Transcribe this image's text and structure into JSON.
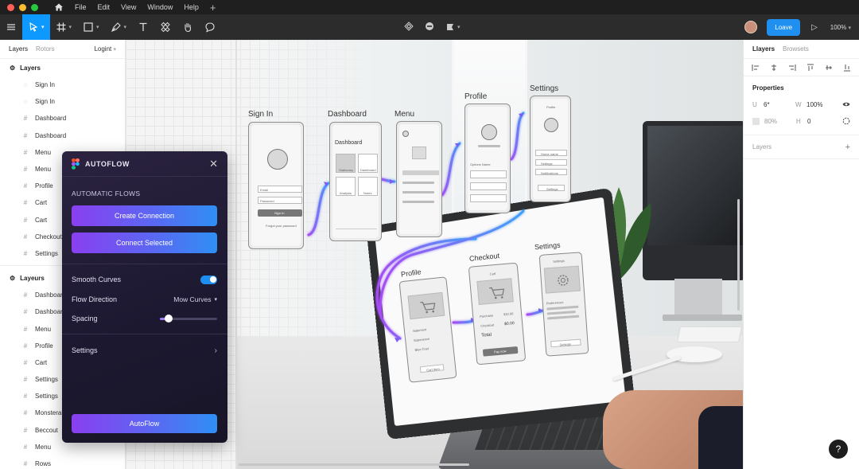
{
  "menubar": {
    "items": [
      "File",
      "Edit",
      "View",
      "Window",
      "Help"
    ],
    "traffic": [
      "#ff5f57",
      "#febc2e",
      "#28c840"
    ]
  },
  "toolbar": {
    "leave_label": "Loave",
    "zoom": "100%",
    "accent": "#0d99ff"
  },
  "left_panel": {
    "tabs": [
      "Layers",
      "Rotors"
    ],
    "page_select": "Logint",
    "section1_title": "Layers",
    "section1_items": [
      {
        "icon": "sign-in-icon",
        "label": "Sign In"
      },
      {
        "icon": "sign-in-icon",
        "label": "Sign In"
      },
      {
        "icon": "frame-icon",
        "label": "Dashboard"
      },
      {
        "icon": "frame-icon",
        "label": "Dashboard"
      },
      {
        "icon": "frame-icon",
        "label": "Menu"
      },
      {
        "icon": "frame-icon",
        "label": "Menu"
      },
      {
        "icon": "frame-icon",
        "label": "Profile"
      },
      {
        "icon": "frame-icon",
        "label": "Cart"
      },
      {
        "icon": "frame-icon",
        "label": "Cart"
      },
      {
        "icon": "frame-icon",
        "label": "Checkout"
      },
      {
        "icon": "frame-icon",
        "label": "Settings"
      }
    ],
    "section2_title": "Layeurs",
    "section2_items": [
      {
        "icon": "frame-icon",
        "label": "Dashboard"
      },
      {
        "icon": "frame-icon",
        "label": "Dashboard"
      },
      {
        "icon": "frame-icon",
        "label": "Menu"
      },
      {
        "icon": "frame-icon",
        "label": "Profile"
      },
      {
        "icon": "frame-icon",
        "label": "Cart"
      },
      {
        "icon": "frame-icon",
        "label": "Settings"
      },
      {
        "icon": "frame-icon",
        "label": "Settings"
      },
      {
        "icon": "frame-icon",
        "label": "Monsteral"
      },
      {
        "icon": "frame-icon",
        "label": "Beccout"
      },
      {
        "icon": "frame-icon",
        "label": "Menu"
      },
      {
        "icon": "frame-icon",
        "label": "Rows"
      }
    ]
  },
  "plugin": {
    "title": "AUTOFLOW",
    "section_title": "AUTOMATIC FLOWS",
    "create_label": "Create Connection",
    "connect_label": "Connect Selected",
    "smooth_label": "Smooth Curves",
    "smooth_on": true,
    "direction_label": "Flow Direction",
    "direction_value": "Mow Curves",
    "spacing_label": "Spacing",
    "spacing_value": 0.15,
    "settings_label": "Settings",
    "autoflow_label": "AutoFlow"
  },
  "canvas": {
    "screens": {
      "signin": {
        "title": "Sign In",
        "field1": "Email",
        "field2": "Password",
        "button": "Sign In",
        "link": "Forgot your password"
      },
      "dashboard": {
        "title": "Dashboard",
        "header": "Dashboard",
        "tile1": "Stationary",
        "tile2": "Dashboard",
        "tile3": "Analysis",
        "tile4": "Notes"
      },
      "menu": {
        "title": "Menu"
      },
      "profile": {
        "title": "Profile",
        "row_label": "Options Name"
      },
      "settings": {
        "title": "Settings",
        "header": "Profile",
        "row1": "Home name",
        "row2": "Settings",
        "row3": "Notifications",
        "button": "Settings"
      }
    },
    "laptop": {
      "profile": {
        "title": "Profile",
        "item1": "Satement",
        "item2": "Esperience",
        "item3": "Blue Cost",
        "button": "Cart Item"
      },
      "checkout": {
        "title": "Checkout",
        "header": "Cart",
        "r1": "Purchase",
        "r1v": "$10.00",
        "r2": "Checkout",
        "r2v": "$0.00",
        "total_label": "Total",
        "button": "Pay now"
      },
      "settings": {
        "title": "Settings",
        "header": "Settings",
        "row1": "Preferences",
        "button": "Settings"
      }
    }
  },
  "right_panel": {
    "tabs": [
      "Llayers",
      "Browsets"
    ],
    "properties_title": "Properties",
    "row1": {
      "k1": "U",
      "v1": "6*",
      "k2": "W",
      "v2": "100%"
    },
    "row2": {
      "v1": "80%",
      "k2": "H",
      "v2": "0"
    },
    "layers_label": "Layers"
  },
  "help_label": "?"
}
